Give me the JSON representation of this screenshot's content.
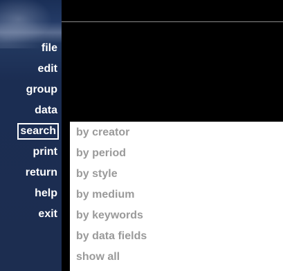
{
  "sidebar": {
    "items": [
      {
        "label": "file"
      },
      {
        "label": "edit"
      },
      {
        "label": "group"
      },
      {
        "label": "data"
      },
      {
        "label": "search"
      },
      {
        "label": "print"
      },
      {
        "label": "return"
      },
      {
        "label": "help"
      },
      {
        "label": "exit"
      }
    ],
    "selected": "search"
  },
  "submenu": {
    "items": [
      {
        "label": "by creator"
      },
      {
        "label": "by period"
      },
      {
        "label": "by style"
      },
      {
        "label": "by medium"
      },
      {
        "label": "by keywords"
      },
      {
        "label": "by data fields"
      },
      {
        "label": "show all"
      }
    ]
  },
  "colors": {
    "sidebar_bg": "#1c2d50",
    "menu_text": "#ffffff",
    "submenu_bg": "#ffffff",
    "submenu_text": "#9a9a9a",
    "main_bg": "#000000"
  }
}
